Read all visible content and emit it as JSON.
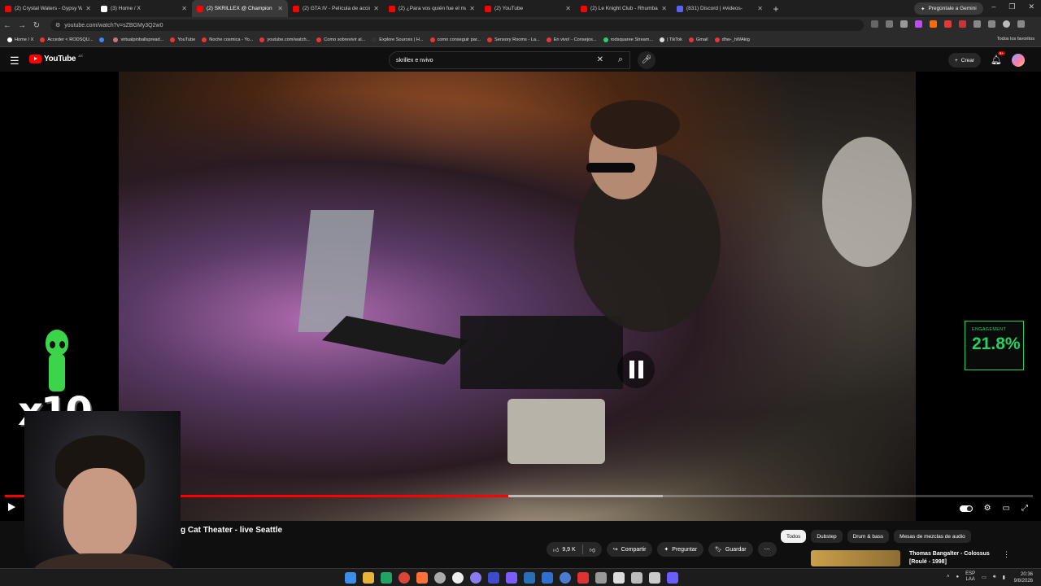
{
  "browser": {
    "tabs": [
      {
        "label": "(2) Crystal Waters - Gypsy Wom",
        "color": "#ff0000"
      },
      {
        "label": "(3) Home / X",
        "color": "#ffffff"
      },
      {
        "label": "(2) SKRILLEX @ Champion",
        "color": "#ff0000",
        "active": true
      },
      {
        "label": "(2) GTA IV - Película de acción",
        "color": "#ff0000"
      },
      {
        "label": "(2) ¿Para vos quién fue el más",
        "color": "#ff0000"
      },
      {
        "label": "(2) YouTube",
        "color": "#ff0000"
      },
      {
        "label": "(2) Le Knight Club - Rhumba",
        "color": "#ff0000"
      },
      {
        "label": "(831) Discord | #videos-",
        "color": "#5865f2"
      }
    ],
    "gemini_label": "Pregúntale a Gemini",
    "url": "youtube.com/watch?v=sZBGMy3Q2w0",
    "bookmarks": [
      "Home / X",
      "Acceder < RODSQU...",
      "",
      "virtualpinballspread...",
      "YouTube",
      "Noche cosmica - Yo...",
      "youtube.com/watch...",
      "Como sobrevivir al...",
      "Explore Sources | H...",
      "como conseguir par...",
      "Sensory Rooms - La...",
      "En vivo! - Consejos...",
      "rodsquaree Stream...",
      "| TikTok",
      "Gmail",
      "dhw-_hWAkig"
    ],
    "bookmarks_all": "Todos los favoritos"
  },
  "youtube": {
    "logo": "YouTube",
    "country": "AR",
    "search_value": "skrillex e nvivo",
    "create_label": "Crear",
    "notifications": "9+"
  },
  "player": {
    "progress_fraction": 0.49,
    "buffered_fraction": 0.64
  },
  "overlay": {
    "engagement_label": "ENGAGEMENT",
    "engagement_value": "21.8%",
    "multiplier": "x10"
  },
  "video": {
    "title_visible": "g Cat Theater - live Seattle",
    "like_count": "9,9 K",
    "share_label": "Compartir",
    "ask_label": "Preguntar",
    "save_label": "Guardar"
  },
  "chips": [
    "Todos",
    "Dubstep",
    "Drum & bass",
    "Mesas de mezclas de audio"
  ],
  "recommendation": {
    "title": "Thomas Bangalter - Colossus [Roulé - 1998]"
  },
  "taskbar": {
    "lang": "ESP",
    "region": "LAA",
    "time": "20:36",
    "date": "9/8/2026"
  }
}
